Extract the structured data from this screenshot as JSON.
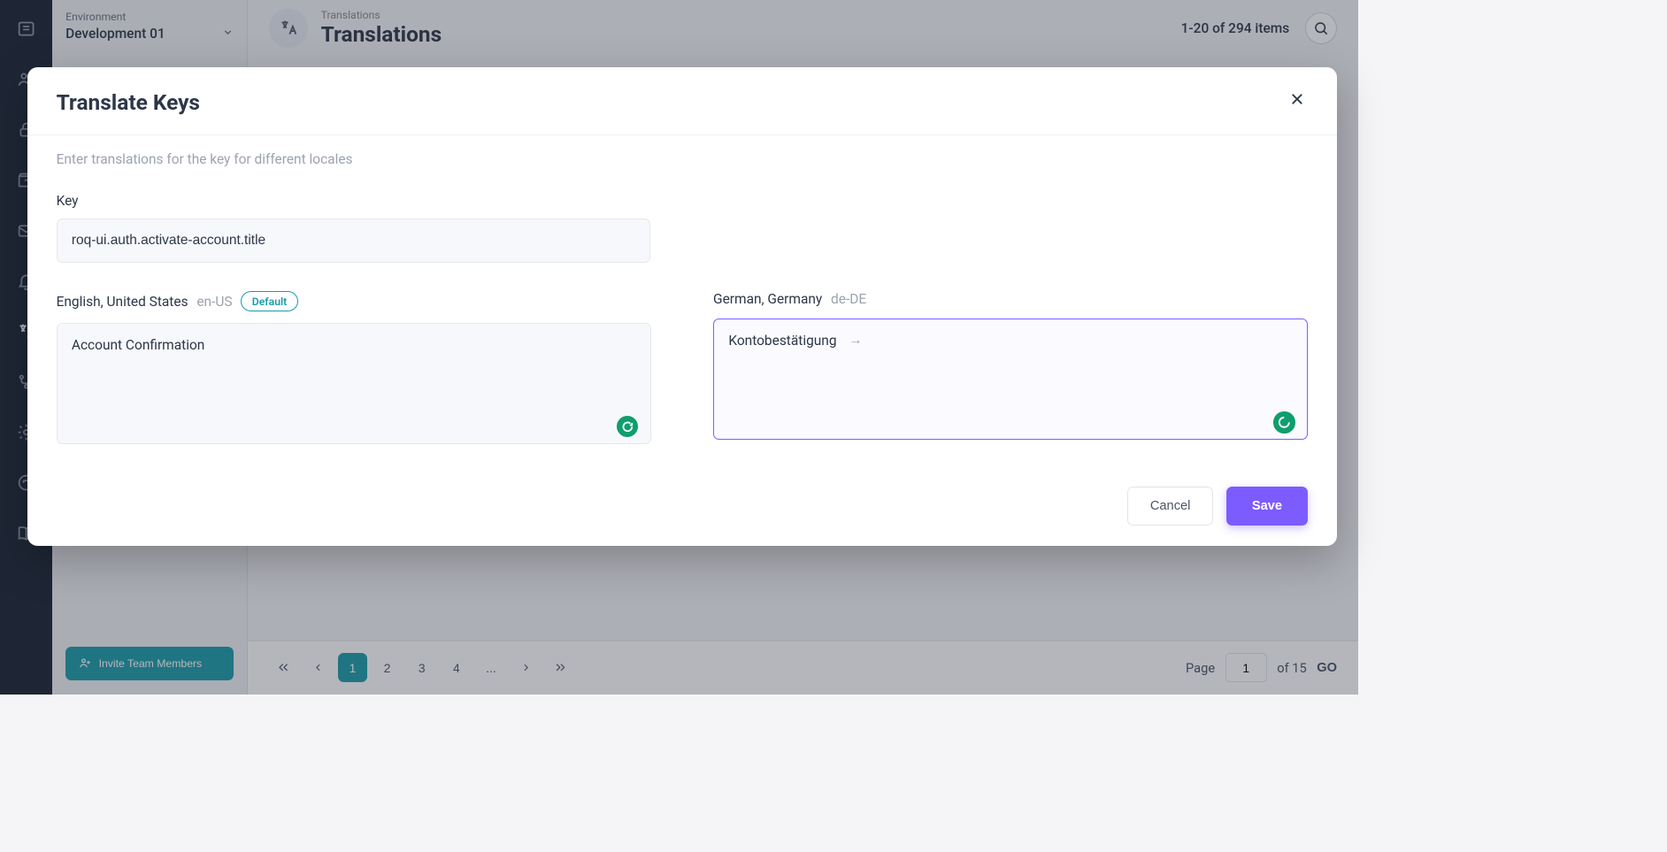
{
  "sidebar": {
    "icons": [
      "list",
      "users",
      "lock",
      "archive",
      "mail",
      "bell",
      "translate",
      "branch",
      "gear",
      "activity",
      "book"
    ]
  },
  "env": {
    "label": "Environment",
    "value": "Development 01",
    "invite_label": "Invite Team Members"
  },
  "header": {
    "breadcrumb": "Translations",
    "title": "Translations",
    "count": "1-20 of 294 items"
  },
  "pagination": {
    "pages": [
      "1",
      "2",
      "3",
      "4",
      "..."
    ],
    "page_label": "Page",
    "current_page": "1",
    "total_label": "of 15",
    "go_label": "GO"
  },
  "modal": {
    "title": "Translate Keys",
    "subtitle": "Enter translations for the key for different locales",
    "key_label": "Key",
    "key_value": "roq-ui.auth.activate-account.title",
    "locale_en": {
      "name": "English, United States",
      "code": "en-US",
      "default_badge": "Default",
      "value": "Account Confirmation"
    },
    "locale_de": {
      "name": "German, Germany",
      "code": "de-DE",
      "value": "Kontobestätigung",
      "hint": "→"
    },
    "cancel_label": "Cancel",
    "save_label": "Save"
  }
}
